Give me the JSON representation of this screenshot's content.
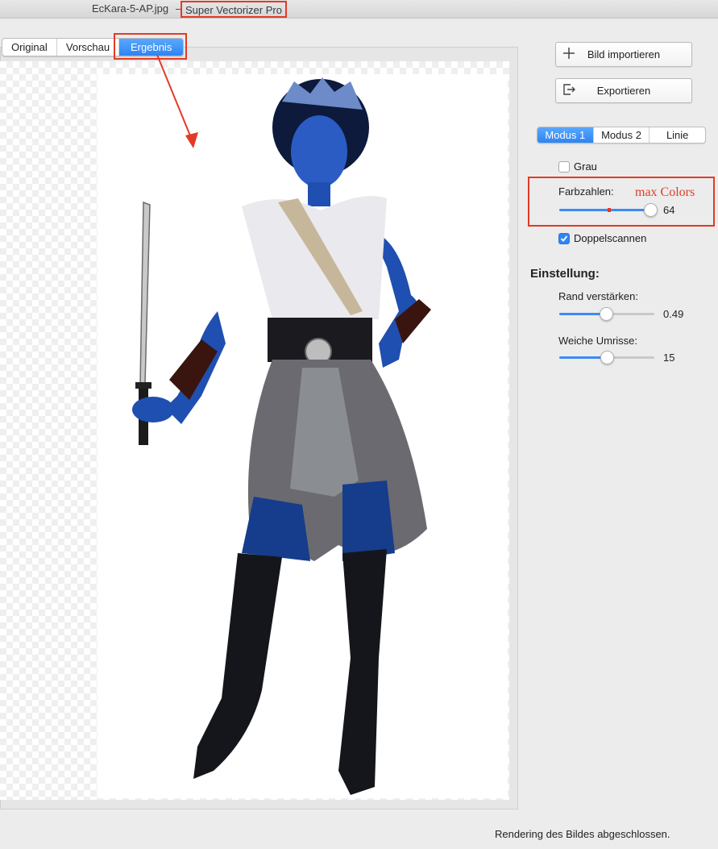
{
  "window": {
    "document_title": "EcKara-5-AP.jpg",
    "separator": "–",
    "app_title": "Super Vectorizer Pro"
  },
  "tabs": [
    {
      "label": "Original",
      "selected": false
    },
    {
      "label": "Vorschau",
      "selected": false
    },
    {
      "label": "Ergebnis",
      "selected": true
    }
  ],
  "toolbar": {
    "import_label": "Bild importieren",
    "import_icon": "plus-icon",
    "export_label": "Exportieren",
    "export_icon": "export-icon"
  },
  "modes": [
    {
      "label": "Modus 1",
      "selected": true
    },
    {
      "label": "Modus 2",
      "selected": false
    },
    {
      "label": "Linie",
      "selected": false
    }
  ],
  "options": {
    "grau_label": "Grau",
    "grau_checked": false,
    "farbzahlen_label": "Farbzahlen:",
    "farbzahlen_value": "64",
    "farbzahlen_level": 1.0,
    "annotation": "max Colors",
    "doppelscannen_label": "Doppelscannen",
    "doppelscannen_checked": true
  },
  "settings": {
    "heading": "Einstellung:",
    "rand_label": "Rand verstärken:",
    "rand_value": "0.49",
    "rand_level": 0.49,
    "weiche_label": "Weiche Umrisse:",
    "weiche_value": "15",
    "weiche_level": 0.5
  },
  "status": {
    "text": "Rendering des Bildes abgeschlossen."
  },
  "colors": {
    "accent": "#2d84f4",
    "annotation_red": "#e23a25",
    "figure_skin": "#1f4fb0",
    "figure_hair": "#0e1a3c"
  }
}
